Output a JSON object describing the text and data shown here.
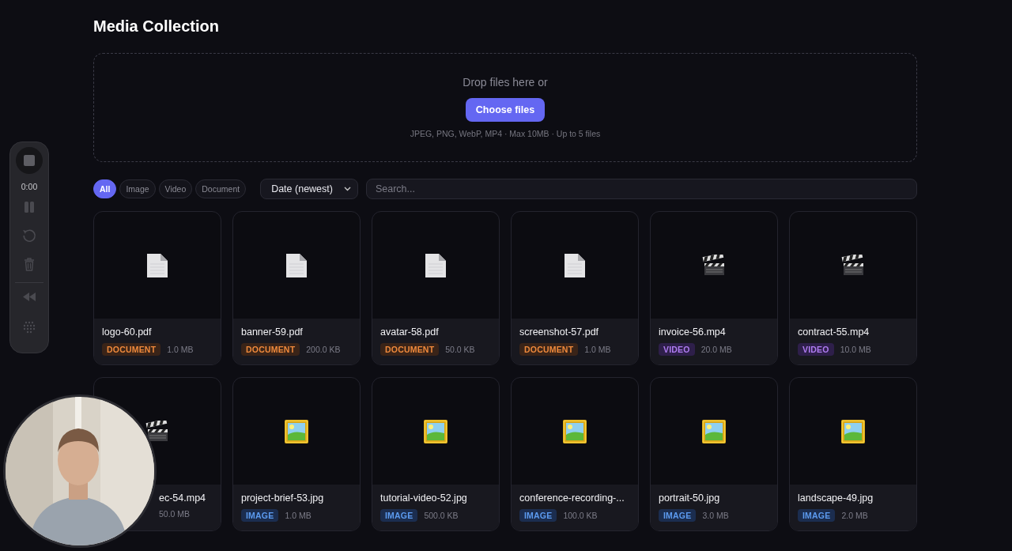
{
  "title": "Media Collection",
  "dropzone": {
    "prompt": "Drop files here or",
    "button": "Choose files",
    "hint": "JPEG, PNG, WebP, MP4 · Max 10MB · Up to 5 files"
  },
  "filters": [
    {
      "label": "All",
      "selected": true
    },
    {
      "label": "Image",
      "selected": false
    },
    {
      "label": "Video",
      "selected": false
    },
    {
      "label": "Document",
      "selected": false
    }
  ],
  "sort": {
    "value": "Date (newest)"
  },
  "search": {
    "placeholder": "Search..."
  },
  "items": [
    {
      "name": "logo-60.pdf",
      "kind": "document",
      "badge": "DOCUMENT",
      "size": "1.0 MB"
    },
    {
      "name": "banner-59.pdf",
      "kind": "document",
      "badge": "DOCUMENT",
      "size": "200.0 KB"
    },
    {
      "name": "avatar-58.pdf",
      "kind": "document",
      "badge": "DOCUMENT",
      "size": "50.0 KB"
    },
    {
      "name": "screenshot-57.pdf",
      "kind": "document",
      "badge": "DOCUMENT",
      "size": "1.0 MB"
    },
    {
      "name": "invoice-56.mp4",
      "kind": "video",
      "badge": "VIDEO",
      "size": "20.0 MB"
    },
    {
      "name": "contract-55.mp4",
      "kind": "video",
      "badge": "VIDEO",
      "size": "10.0 MB"
    },
    {
      "name": "ec-54.mp4",
      "kind": "video",
      "covered": true,
      "size": "50.0 MB"
    },
    {
      "name": "project-brief-53.jpg",
      "badge": "IMAGE",
      "size": "1.0 MB"
    },
    {
      "name": "tutorial-video-52.jpg",
      "badge": "IMAGE",
      "size": "500.0 KB"
    },
    {
      "name": "conference-recording-...",
      "badge": "IMAGE",
      "size": "100.0 KB"
    },
    {
      "name": "portrait-50.jpg",
      "badge": "IMAGE",
      "size": "3.0 MB"
    },
    {
      "name": "landscape-49.jpg",
      "badge": "IMAGE",
      "size": "2.0 MB"
    }
  ],
  "recorder": {
    "time": "0:00"
  }
}
